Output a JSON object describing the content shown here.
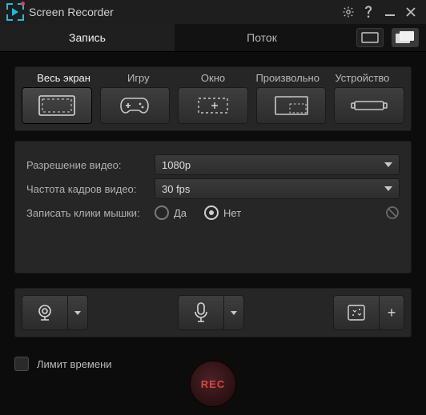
{
  "title": "Screen Recorder",
  "tabs": {
    "record": "Запись",
    "stream": "Поток"
  },
  "modes": {
    "fullscreen": "Весь экран",
    "game": "Игру",
    "window": "Окно",
    "custom": "Произвольно",
    "device": "Устройство"
  },
  "settings": {
    "resolution_label": "Разрешение видео:",
    "resolution_value": "1080p",
    "framerate_label": "Частота кадров видео:",
    "framerate_value": "30 fps",
    "clicks_label": "Записать клики мышки:",
    "yes": "Да",
    "no": "Нет",
    "clicks_selected": "no"
  },
  "bottom": {
    "time_limit_label": "Лимит времени",
    "rec_label": "REC"
  },
  "colors": {
    "accent": "#26b8d8",
    "rec": "#d04a44"
  }
}
